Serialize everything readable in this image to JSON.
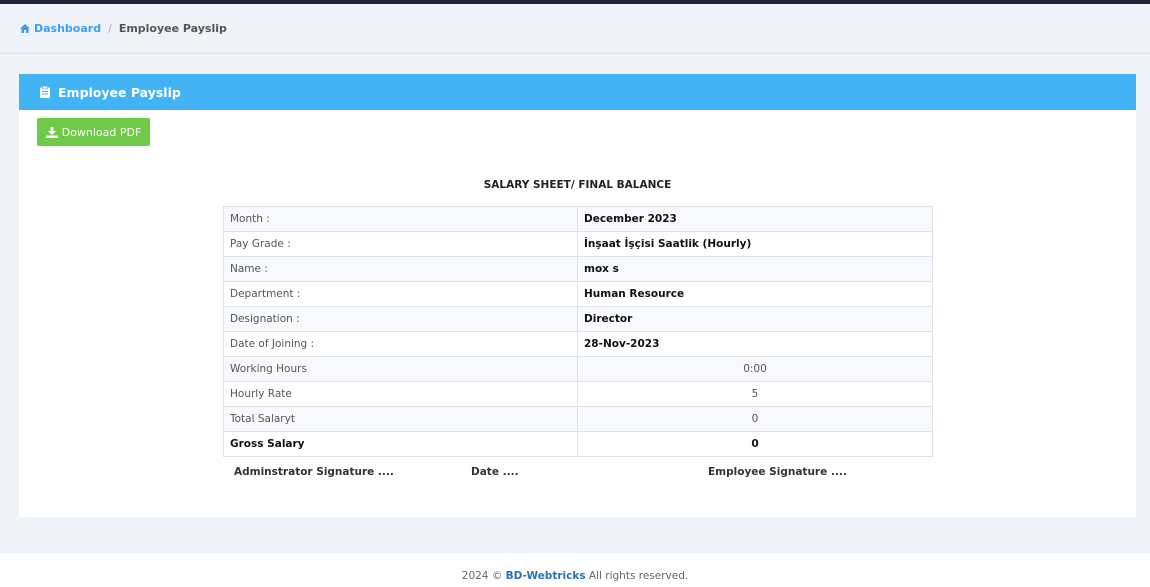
{
  "breadcrumb": {
    "home_label": "Dashboard",
    "current": "Employee Payslip"
  },
  "card": {
    "title": "Employee Payslip",
    "download_label": "Download PDF"
  },
  "sheet": {
    "title": "SALARY SHEET/ FINAL BALANCE",
    "rows": [
      {
        "label": "Month :",
        "value": "December 2023"
      },
      {
        "label": "Pay Grade :",
        "value": "İnşaat İşçisi Saatlik (Hourly)"
      },
      {
        "label": "Name :",
        "value": "mox s"
      },
      {
        "label": "Department :",
        "value": "Human Resource"
      },
      {
        "label": "Designation :",
        "value": "Director"
      },
      {
        "label": "Date of Joining :",
        "value": "28-Nov-2023"
      },
      {
        "label": "Working Hours",
        "value": "0:00"
      },
      {
        "label": "Hourly Rate",
        "value": "5"
      },
      {
        "label": "Total Salaryt",
        "value": "0"
      },
      {
        "label": "Gross Salary",
        "value": "0"
      }
    ]
  },
  "signatures": {
    "admin": "Adminstrator Signature ....",
    "date": "Date ....",
    "employee": "Employee Signature ...."
  },
  "footer": {
    "year": "2024 ©",
    "brand": "BD-Webtricks",
    "rights": "All rights reserved."
  },
  "colors": {
    "header_bg": "#42b3f5",
    "button_bg": "#6fca47",
    "link": "#3f9fef"
  }
}
